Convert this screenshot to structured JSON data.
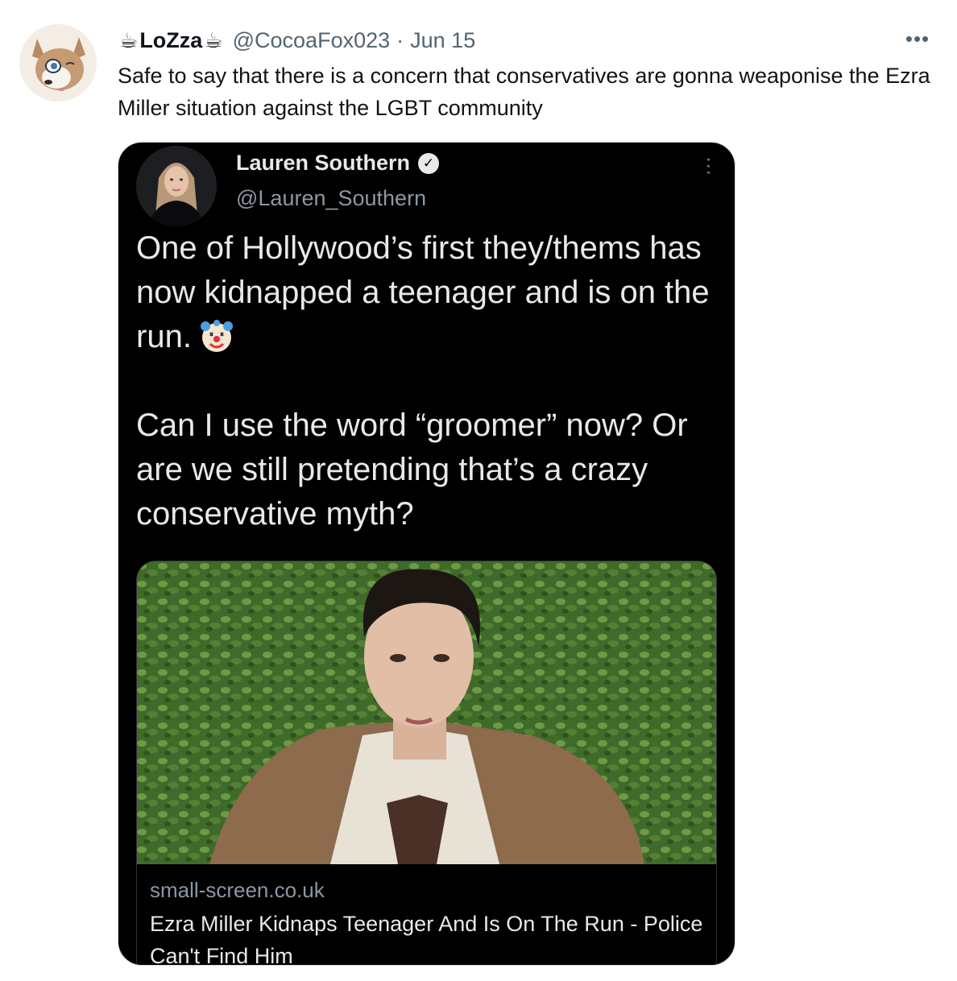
{
  "tweet": {
    "author_name": "LoZza",
    "name_emoji": "☕",
    "handle": "@CocoaFox023",
    "separator": "·",
    "date": "Jun 15",
    "more_icon": "•••",
    "text": "Safe to say that there is a concern that conservatives are gonna weaponise the Ezra Miller situation against the LGBT community"
  },
  "quoted": {
    "author_name": "Lauren Southern",
    "verified_mark": "✓",
    "handle": "@Lauren_Southern",
    "more_icon": "⋯",
    "paragraph_1": "One of Hollywood’s first they/thems has now kidnapped a teenager and is on the run.",
    "paragraph_2": "Can I use the word “groomer” now? Or are we still pretending that’s a crazy conservative myth?",
    "card": {
      "domain": "small-screen.co.uk",
      "title": "Ezra Miller Kidnaps Teenager And Is On The Run - Police Can't Find Him"
    }
  }
}
